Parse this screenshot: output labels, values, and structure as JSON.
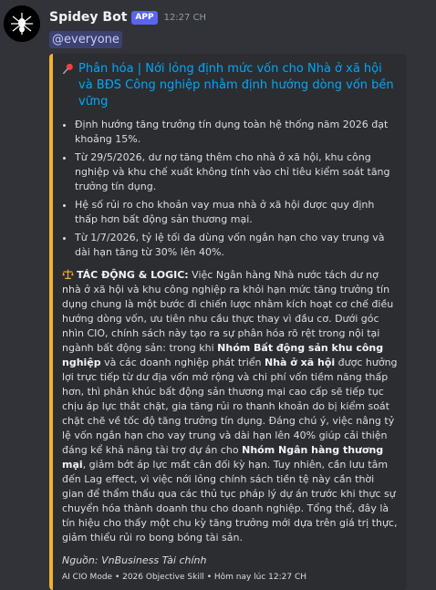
{
  "message": {
    "author": "Spidey Bot",
    "badge": "APP",
    "timestamp": "12:27 CH",
    "mention": "@everyone"
  },
  "embed": {
    "accent_color": "#f0b232",
    "title_icon": "pushpin-icon",
    "title": "Phân hóa | Nới lỏng định mức vốn cho Nhà ở xã hội và BĐS Công nghiệp nhằm định hướng dòng vốn bền vững",
    "bullets": [
      "Định hướng tăng trưởng tín dụng toàn hệ thống năm 2026 đạt khoảng 15%.",
      "Từ 29/5/2026, dư nợ tăng thêm cho nhà ở xã hội, khu công nghiệp và khu chế xuất không tính vào chỉ tiêu kiểm soát tăng trưởng tín dụng.",
      "Hệ số rủi ro cho khoản vay mua nhà ở xã hội được quy định thấp hơn bất động sản thương mại.",
      "Từ 1/7/2026, tỷ lệ tối đa dùng vốn ngắn hạn cho vay trung và dài hạn tăng từ 30% lên 40%."
    ],
    "analysis": {
      "icon": "scales-icon",
      "heading": "TÁC ĐỘNG & LOGIC:",
      "p1": " Việc Ngân hàng Nhà nước tách dư nợ nhà ở xã hội và khu công nghiệp ra khỏi hạn mức tăng trưởng tín dụng chung là một bước đi chiến lược nhằm kích hoạt cơ chế điều hướng dòng vốn, ưu tiên nhu cầu thực thay vì đầu cơ. Dưới góc nhìn CIO, chính sách này tạo ra sự phân hóa rõ rệt trong nội tại ngành bất động sản: trong khi ",
      "b1": "Nhóm Bất động sản khu công nghiệp",
      "p2": " và các doanh nghiệp phát triển ",
      "b2": "Nhà ở xã hội",
      "p3": " được hưởng lợi trực tiếp từ dư địa vốn mở rộng và chi phí vốn tiềm năng thấp hơn, thì phân khúc bất động sản thương mại cao cấp sẽ tiếp tục chịu áp lực thắt chặt, gia tăng rủi ro thanh khoản do bị kiểm soát chặt chẽ về tốc độ tăng trưởng tín dụng. Đáng chú ý, việc nâng tỷ lệ vốn ngắn hạn cho vay trung và dài hạn lên 40% giúp cải thiện đáng kể khả năng tài trợ dự án cho ",
      "b3": "Nhóm Ngân hàng thương mại",
      "p4": ", giảm bớt áp lực mất cân đối kỳ hạn. Tuy nhiên, cần lưu tâm đến Lag effect, vì việc nới lỏng chính sách tiền tệ này cần thời gian để thẩm thấu qua các thủ tục pháp lý dự án trước khi thực sự chuyển hóa thành doanh thu cho doanh nghiệp. Tổng thể, đây là tín hiệu cho thấy một chu kỳ tăng trưởng mới dựa trên giá trị thực, giảm thiểu rủi ro bong bóng tài sản."
    },
    "source": "Nguồn: VnBusiness Tài chính",
    "footer": "AI CIO Mode • 2026 Objective Skill • Hôm nay lúc 12:27 CH"
  }
}
